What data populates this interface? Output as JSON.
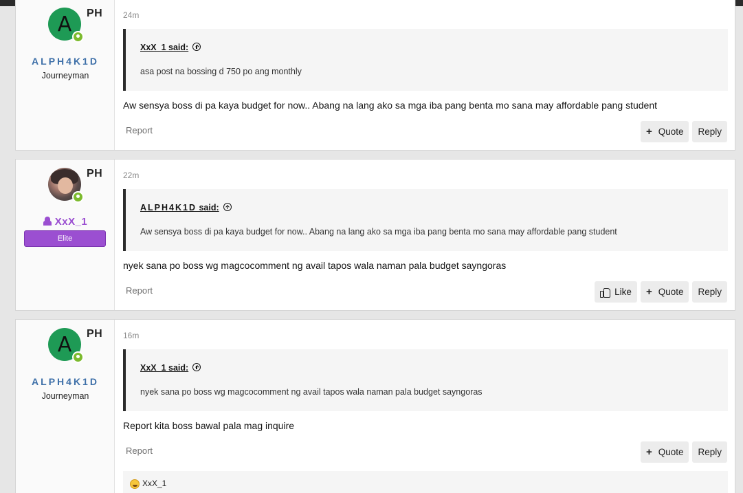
{
  "posts": [
    {
      "flag": "PH",
      "avatar_letter": "A",
      "username": "ALPH4K1D",
      "user_title": "Journeyman",
      "time": "24m",
      "quote_author": "XxX_1 said:",
      "quote_text": "asa post na bossing d 750 po ang monthly",
      "message": "Aw sensya boss di pa kaya budget for now.. Abang na lang ako sa mga iba pang benta mo sana may affordable pang student",
      "report_label": "Report",
      "quote_label": "Quote",
      "reply_label": "Reply"
    },
    {
      "flag": "PH",
      "username": "XxX_1",
      "badge": "Elite",
      "time": "22m",
      "quote_author": "ALPH4K1D",
      "quote_said": " said:",
      "quote_text": "Aw sensya boss di pa kaya budget for now.. Abang na lang ako sa mga iba pang benta mo sana may affordable pang student",
      "message": "nyek sana po boss wg magcocomment ng avail tapos wala naman pala budget sayngoras",
      "report_label": "Report",
      "like_label": "Like",
      "quote_label": "Quote",
      "reply_label": "Reply"
    },
    {
      "flag": "PH",
      "avatar_letter": "A",
      "username": "ALPH4K1D",
      "user_title": "Journeyman",
      "time": "16m",
      "quote_author": "XxX_1 said:",
      "quote_text": "nyek sana po boss wg magcocomment ng avail tapos wala naman pala budget sayngoras",
      "message": "Report kita boss bawal pala mag inquire",
      "report_label": "Report",
      "quote_label": "Quote",
      "reply_label": "Reply",
      "reaction_user": "XxX_1"
    }
  ],
  "colors": {
    "avatar_green": "#1e9a55",
    "username_blue": "#3d6fa8",
    "elite_purple": "#9b4fd1",
    "online_green": "#7cba2e"
  }
}
